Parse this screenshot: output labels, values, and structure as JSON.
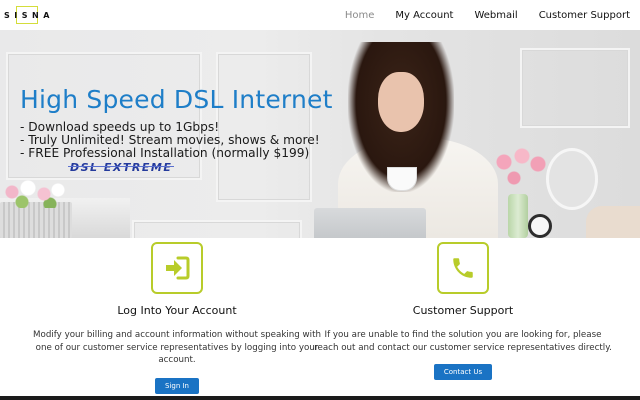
{
  "brand": {
    "logo_text": "SISNA",
    "accent_color": "#b8cc2a"
  },
  "nav": {
    "items": [
      {
        "label": "Home",
        "active": true
      },
      {
        "label": "My Account",
        "active": false
      },
      {
        "label": "Webmail",
        "active": false
      },
      {
        "label": "Customer Support",
        "active": false
      }
    ]
  },
  "hero": {
    "title": "High Speed DSL Internet",
    "title_color": "#1e7ec8",
    "bullets": [
      "- Download speeds up to 1Gbps!",
      "- Truly Unlimited! Stream movies, shows & more!",
      "- FREE Professional Installation (normally $199)"
    ],
    "product_logo": "DSL EXTREME"
  },
  "features": [
    {
      "icon": "sign-in-icon",
      "heading": "Log Into Your Account",
      "description": "Modify your billing and account information without speaking with one of our customer service representatives by logging into your account.",
      "button_label": "Sign In"
    },
    {
      "icon": "phone-icon",
      "heading": "Customer Support",
      "description": "If you are unable to find the solution you are looking for, please reach out and contact our customer service representatives directly.",
      "button_label": "Contact Us"
    }
  ],
  "colors": {
    "button": "#1a73c4",
    "icon_border": "#b8cc2a"
  }
}
